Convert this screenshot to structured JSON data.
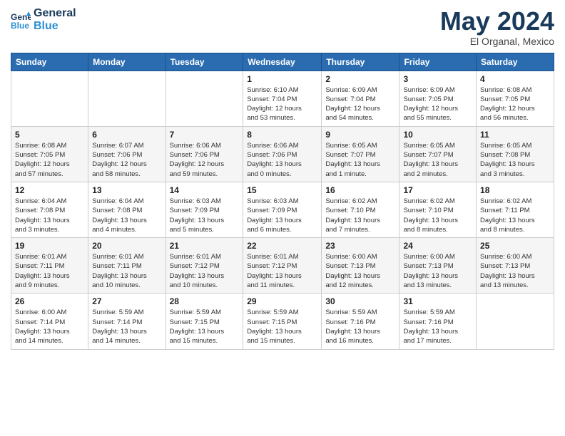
{
  "header": {
    "logo_line1": "General",
    "logo_line2": "Blue",
    "month": "May 2024",
    "location": "El Organal, Mexico"
  },
  "weekdays": [
    "Sunday",
    "Monday",
    "Tuesday",
    "Wednesday",
    "Thursday",
    "Friday",
    "Saturday"
  ],
  "weeks": [
    [
      {
        "day": "",
        "info": ""
      },
      {
        "day": "",
        "info": ""
      },
      {
        "day": "",
        "info": ""
      },
      {
        "day": "1",
        "info": "Sunrise: 6:10 AM\nSunset: 7:04 PM\nDaylight: 12 hours\nand 53 minutes."
      },
      {
        "day": "2",
        "info": "Sunrise: 6:09 AM\nSunset: 7:04 PM\nDaylight: 12 hours\nand 54 minutes."
      },
      {
        "day": "3",
        "info": "Sunrise: 6:09 AM\nSunset: 7:05 PM\nDaylight: 12 hours\nand 55 minutes."
      },
      {
        "day": "4",
        "info": "Sunrise: 6:08 AM\nSunset: 7:05 PM\nDaylight: 12 hours\nand 56 minutes."
      }
    ],
    [
      {
        "day": "5",
        "info": "Sunrise: 6:08 AM\nSunset: 7:05 PM\nDaylight: 12 hours\nand 57 minutes."
      },
      {
        "day": "6",
        "info": "Sunrise: 6:07 AM\nSunset: 7:06 PM\nDaylight: 12 hours\nand 58 minutes."
      },
      {
        "day": "7",
        "info": "Sunrise: 6:06 AM\nSunset: 7:06 PM\nDaylight: 12 hours\nand 59 minutes."
      },
      {
        "day": "8",
        "info": "Sunrise: 6:06 AM\nSunset: 7:06 PM\nDaylight: 13 hours\nand 0 minutes."
      },
      {
        "day": "9",
        "info": "Sunrise: 6:05 AM\nSunset: 7:07 PM\nDaylight: 13 hours\nand 1 minute."
      },
      {
        "day": "10",
        "info": "Sunrise: 6:05 AM\nSunset: 7:07 PM\nDaylight: 13 hours\nand 2 minutes."
      },
      {
        "day": "11",
        "info": "Sunrise: 6:05 AM\nSunset: 7:08 PM\nDaylight: 13 hours\nand 3 minutes."
      }
    ],
    [
      {
        "day": "12",
        "info": "Sunrise: 6:04 AM\nSunset: 7:08 PM\nDaylight: 13 hours\nand 3 minutes."
      },
      {
        "day": "13",
        "info": "Sunrise: 6:04 AM\nSunset: 7:08 PM\nDaylight: 13 hours\nand 4 minutes."
      },
      {
        "day": "14",
        "info": "Sunrise: 6:03 AM\nSunset: 7:09 PM\nDaylight: 13 hours\nand 5 minutes."
      },
      {
        "day": "15",
        "info": "Sunrise: 6:03 AM\nSunset: 7:09 PM\nDaylight: 13 hours\nand 6 minutes."
      },
      {
        "day": "16",
        "info": "Sunrise: 6:02 AM\nSunset: 7:10 PM\nDaylight: 13 hours\nand 7 minutes."
      },
      {
        "day": "17",
        "info": "Sunrise: 6:02 AM\nSunset: 7:10 PM\nDaylight: 13 hours\nand 8 minutes."
      },
      {
        "day": "18",
        "info": "Sunrise: 6:02 AM\nSunset: 7:11 PM\nDaylight: 13 hours\nand 8 minutes."
      }
    ],
    [
      {
        "day": "19",
        "info": "Sunrise: 6:01 AM\nSunset: 7:11 PM\nDaylight: 13 hours\nand 9 minutes."
      },
      {
        "day": "20",
        "info": "Sunrise: 6:01 AM\nSunset: 7:11 PM\nDaylight: 13 hours\nand 10 minutes."
      },
      {
        "day": "21",
        "info": "Sunrise: 6:01 AM\nSunset: 7:12 PM\nDaylight: 13 hours\nand 10 minutes."
      },
      {
        "day": "22",
        "info": "Sunrise: 6:01 AM\nSunset: 7:12 PM\nDaylight: 13 hours\nand 11 minutes."
      },
      {
        "day": "23",
        "info": "Sunrise: 6:00 AM\nSunset: 7:13 PM\nDaylight: 13 hours\nand 12 minutes."
      },
      {
        "day": "24",
        "info": "Sunrise: 6:00 AM\nSunset: 7:13 PM\nDaylight: 13 hours\nand 13 minutes."
      },
      {
        "day": "25",
        "info": "Sunrise: 6:00 AM\nSunset: 7:13 PM\nDaylight: 13 hours\nand 13 minutes."
      }
    ],
    [
      {
        "day": "26",
        "info": "Sunrise: 6:00 AM\nSunset: 7:14 PM\nDaylight: 13 hours\nand 14 minutes."
      },
      {
        "day": "27",
        "info": "Sunrise: 5:59 AM\nSunset: 7:14 PM\nDaylight: 13 hours\nand 14 minutes."
      },
      {
        "day": "28",
        "info": "Sunrise: 5:59 AM\nSunset: 7:15 PM\nDaylight: 13 hours\nand 15 minutes."
      },
      {
        "day": "29",
        "info": "Sunrise: 5:59 AM\nSunset: 7:15 PM\nDaylight: 13 hours\nand 15 minutes."
      },
      {
        "day": "30",
        "info": "Sunrise: 5:59 AM\nSunset: 7:16 PM\nDaylight: 13 hours\nand 16 minutes."
      },
      {
        "day": "31",
        "info": "Sunrise: 5:59 AM\nSunset: 7:16 PM\nDaylight: 13 hours\nand 17 minutes."
      },
      {
        "day": "",
        "info": ""
      }
    ]
  ]
}
